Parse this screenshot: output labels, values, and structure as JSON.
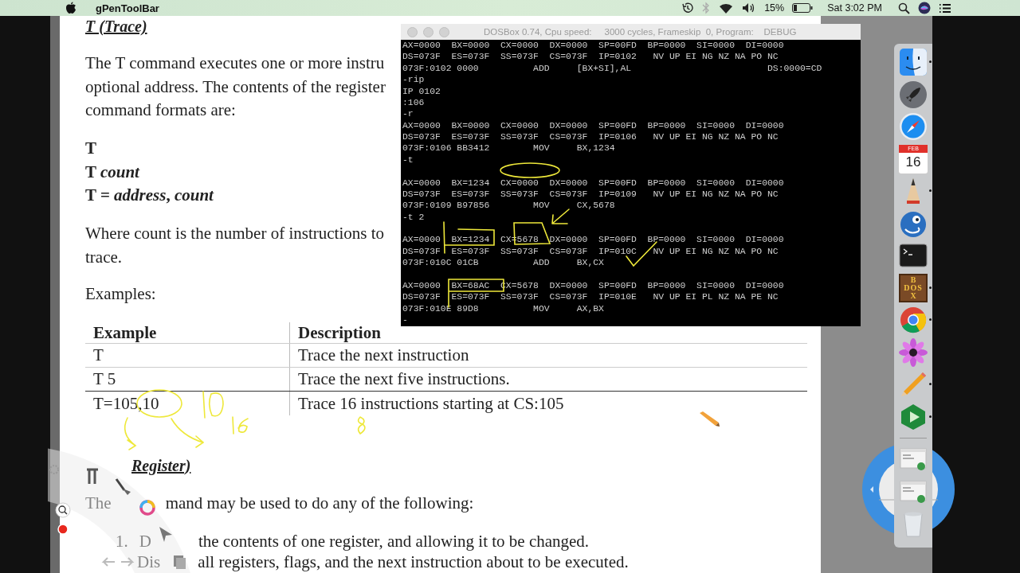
{
  "menu_bar": {
    "app_name": "gPenToolBar",
    "battery": "15%",
    "clock": "Sat 3:02 PM"
  },
  "document": {
    "heading": "T (Trace)",
    "intro_lines": [
      "The T command executes one or more instru",
      "optional address. The contents of the register",
      "command formats are:"
    ],
    "formats": [
      "T",
      "T *count*",
      "T = *address*, *count*"
    ],
    "count_lines": [
      "Where count is the number of instructions to",
      "trace."
    ],
    "examples_label": "Examples:",
    "table": {
      "columns": [
        "Example",
        "Description"
      ],
      "rows": [
        [
          "T",
          "Trace the next instruction"
        ],
        [
          "T 5",
          "Trace the next five instructions."
        ],
        [
          "T=105,10",
          "Trace 16 instructions starting at CS:105"
        ]
      ]
    },
    "next_heading": "Register)",
    "next_intro": [
      "The",
      "mand may be used to do any of the following:"
    ],
    "list": [
      {
        "number": "1.",
        "parts": [
          "D",
          "the contents of one register, and allowing it to be changed."
        ]
      },
      {
        "parts": [
          "Dis",
          "all registers, flags, and the next instruction about to be executed."
        ]
      }
    ]
  },
  "dosbox": {
    "title": "DOSBox 0.74, Cpu speed:     3000 cycles, Frameskip  0, Program:    DEBUG",
    "blocks": [
      [
        "AX=0000  BX=0000  CX=0000  DX=0000  SP=00FD  BP=0000  SI=0000  DI=0000",
        "DS=073F  ES=073F  SS=073F  CS=073F  IP=0102   NV UP EI NG NZ NA PO NC",
        "073F:0102 0000          ADD     [BX+SI],AL                         DS:0000=CD",
        "-rip",
        "IP 0102",
        ":106",
        "-r",
        "AX=0000  BX=0000  CX=0000  DX=0000  SP=00FD  BP=0000  SI=0000  DI=0000",
        "DS=073F  ES=073F  SS=073F  CS=073F  IP=0106   NV UP EI NG NZ NA PO NC",
        "073F:0106 BB3412        MOV     BX,1234",
        "-t"
      ],
      [
        "AX=0000  BX=1234  CX=0000  DX=0000  SP=00FD  BP=0000  SI=0000  DI=0000",
        "DS=073F  ES=073F  SS=073F  CS=073F  IP=0109   NV UP EI NG NZ NA PO NC",
        "073F:0109 B97856        MOV     CX,5678",
        "-t 2"
      ],
      [
        "AX=0000  BX=1234  CX=5678  DX=0000  SP=00FD  BP=0000  SI=0000  DI=0000",
        "DS=073F  ES=073F  SS=073F  CS=073F  IP=010C   NV UP EI NG NZ NA PO NC",
        "073F:010C 01CB          ADD     BX,CX"
      ],
      [
        "AX=0000  BX=68AC  CX=5678  DX=0000  SP=00FD  BP=0000  SI=0000  DI=0000",
        "DS=073F  ES=073F  SS=073F  CS=073F  IP=010E   NV UP EI PL NZ NA PE NC",
        "073F:010E 89D8          MOV     AX,BX",
        "-"
      ]
    ]
  },
  "dock": {
    "items": [
      {
        "kind": "finder",
        "running": true
      },
      {
        "kind": "rocket",
        "running": false
      },
      {
        "kind": "compass",
        "running": false
      },
      {
        "kind": "calendar",
        "month": "FEB",
        "day": "16",
        "running": false
      },
      {
        "kind": "sketch",
        "running": true
      },
      {
        "kind": "chameleon",
        "running": false
      },
      {
        "kind": "terminal",
        "running": false
      },
      {
        "kind": "crate",
        "letters": [
          "B",
          "DOS",
          "X"
        ],
        "running": true
      },
      {
        "kind": "chrome",
        "running": true
      },
      {
        "kind": "flower",
        "running": false
      },
      {
        "kind": "pencil",
        "running": true
      },
      {
        "kind": "player",
        "running": true
      },
      {
        "kind": "separator"
      },
      {
        "kind": "thumbnail",
        "running": false
      },
      {
        "kind": "thumbnail",
        "running": false
      },
      {
        "kind": "trash",
        "running": false
      }
    ]
  }
}
